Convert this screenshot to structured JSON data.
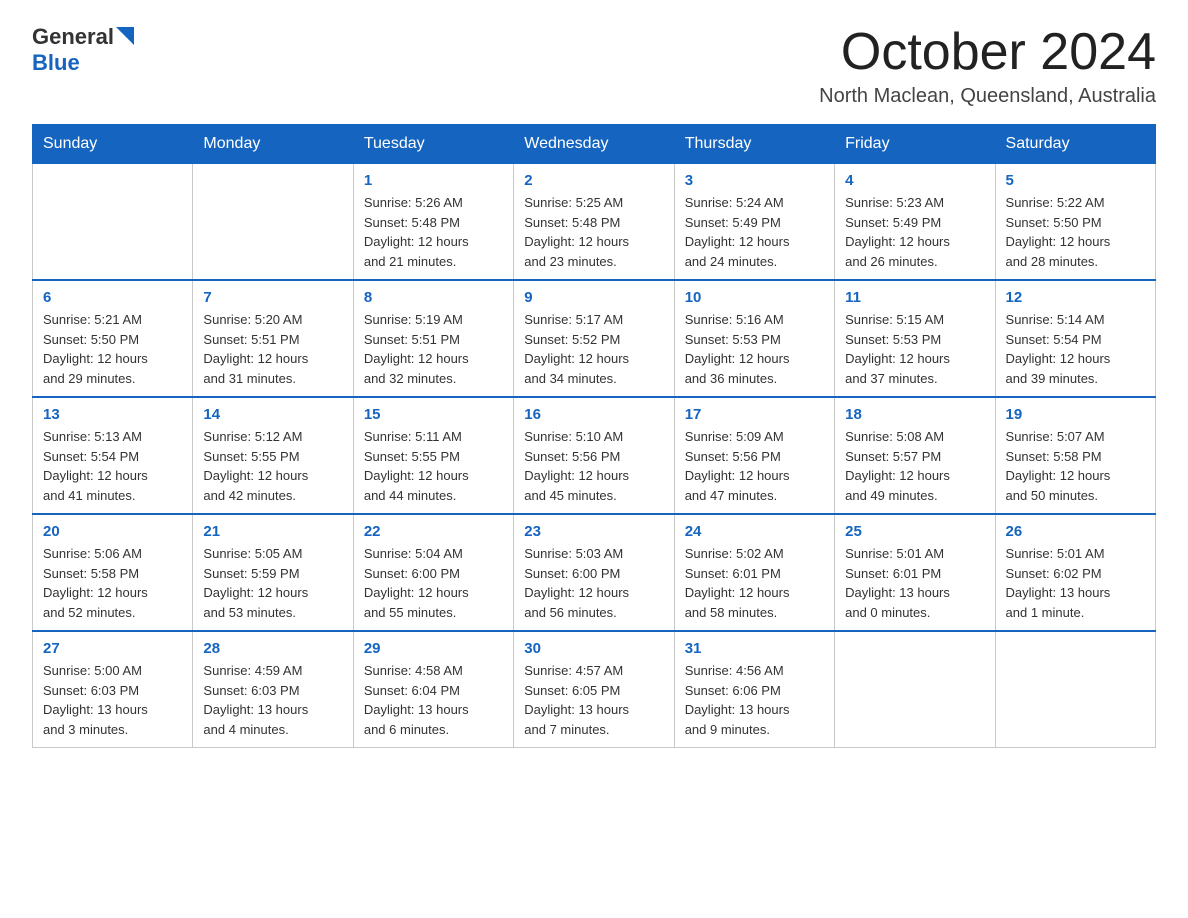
{
  "logo": {
    "general": "General",
    "triangle": "▶",
    "blue": "Blue"
  },
  "title": {
    "month_year": "October 2024",
    "location": "North Maclean, Queensland, Australia"
  },
  "weekdays": [
    "Sunday",
    "Monday",
    "Tuesday",
    "Wednesday",
    "Thursday",
    "Friday",
    "Saturday"
  ],
  "weeks": [
    [
      {
        "day": "",
        "info": ""
      },
      {
        "day": "",
        "info": ""
      },
      {
        "day": "1",
        "info": "Sunrise: 5:26 AM\nSunset: 5:48 PM\nDaylight: 12 hours\nand 21 minutes."
      },
      {
        "day": "2",
        "info": "Sunrise: 5:25 AM\nSunset: 5:48 PM\nDaylight: 12 hours\nand 23 minutes."
      },
      {
        "day": "3",
        "info": "Sunrise: 5:24 AM\nSunset: 5:49 PM\nDaylight: 12 hours\nand 24 minutes."
      },
      {
        "day": "4",
        "info": "Sunrise: 5:23 AM\nSunset: 5:49 PM\nDaylight: 12 hours\nand 26 minutes."
      },
      {
        "day": "5",
        "info": "Sunrise: 5:22 AM\nSunset: 5:50 PM\nDaylight: 12 hours\nand 28 minutes."
      }
    ],
    [
      {
        "day": "6",
        "info": "Sunrise: 5:21 AM\nSunset: 5:50 PM\nDaylight: 12 hours\nand 29 minutes."
      },
      {
        "day": "7",
        "info": "Sunrise: 5:20 AM\nSunset: 5:51 PM\nDaylight: 12 hours\nand 31 minutes."
      },
      {
        "day": "8",
        "info": "Sunrise: 5:19 AM\nSunset: 5:51 PM\nDaylight: 12 hours\nand 32 minutes."
      },
      {
        "day": "9",
        "info": "Sunrise: 5:17 AM\nSunset: 5:52 PM\nDaylight: 12 hours\nand 34 minutes."
      },
      {
        "day": "10",
        "info": "Sunrise: 5:16 AM\nSunset: 5:53 PM\nDaylight: 12 hours\nand 36 minutes."
      },
      {
        "day": "11",
        "info": "Sunrise: 5:15 AM\nSunset: 5:53 PM\nDaylight: 12 hours\nand 37 minutes."
      },
      {
        "day": "12",
        "info": "Sunrise: 5:14 AM\nSunset: 5:54 PM\nDaylight: 12 hours\nand 39 minutes."
      }
    ],
    [
      {
        "day": "13",
        "info": "Sunrise: 5:13 AM\nSunset: 5:54 PM\nDaylight: 12 hours\nand 41 minutes."
      },
      {
        "day": "14",
        "info": "Sunrise: 5:12 AM\nSunset: 5:55 PM\nDaylight: 12 hours\nand 42 minutes."
      },
      {
        "day": "15",
        "info": "Sunrise: 5:11 AM\nSunset: 5:55 PM\nDaylight: 12 hours\nand 44 minutes."
      },
      {
        "day": "16",
        "info": "Sunrise: 5:10 AM\nSunset: 5:56 PM\nDaylight: 12 hours\nand 45 minutes."
      },
      {
        "day": "17",
        "info": "Sunrise: 5:09 AM\nSunset: 5:56 PM\nDaylight: 12 hours\nand 47 minutes."
      },
      {
        "day": "18",
        "info": "Sunrise: 5:08 AM\nSunset: 5:57 PM\nDaylight: 12 hours\nand 49 minutes."
      },
      {
        "day": "19",
        "info": "Sunrise: 5:07 AM\nSunset: 5:58 PM\nDaylight: 12 hours\nand 50 minutes."
      }
    ],
    [
      {
        "day": "20",
        "info": "Sunrise: 5:06 AM\nSunset: 5:58 PM\nDaylight: 12 hours\nand 52 minutes."
      },
      {
        "day": "21",
        "info": "Sunrise: 5:05 AM\nSunset: 5:59 PM\nDaylight: 12 hours\nand 53 minutes."
      },
      {
        "day": "22",
        "info": "Sunrise: 5:04 AM\nSunset: 6:00 PM\nDaylight: 12 hours\nand 55 minutes."
      },
      {
        "day": "23",
        "info": "Sunrise: 5:03 AM\nSunset: 6:00 PM\nDaylight: 12 hours\nand 56 minutes."
      },
      {
        "day": "24",
        "info": "Sunrise: 5:02 AM\nSunset: 6:01 PM\nDaylight: 12 hours\nand 58 minutes."
      },
      {
        "day": "25",
        "info": "Sunrise: 5:01 AM\nSunset: 6:01 PM\nDaylight: 13 hours\nand 0 minutes."
      },
      {
        "day": "26",
        "info": "Sunrise: 5:01 AM\nSunset: 6:02 PM\nDaylight: 13 hours\nand 1 minute."
      }
    ],
    [
      {
        "day": "27",
        "info": "Sunrise: 5:00 AM\nSunset: 6:03 PM\nDaylight: 13 hours\nand 3 minutes."
      },
      {
        "day": "28",
        "info": "Sunrise: 4:59 AM\nSunset: 6:03 PM\nDaylight: 13 hours\nand 4 minutes."
      },
      {
        "day": "29",
        "info": "Sunrise: 4:58 AM\nSunset: 6:04 PM\nDaylight: 13 hours\nand 6 minutes."
      },
      {
        "day": "30",
        "info": "Sunrise: 4:57 AM\nSunset: 6:05 PM\nDaylight: 13 hours\nand 7 minutes."
      },
      {
        "day": "31",
        "info": "Sunrise: 4:56 AM\nSunset: 6:06 PM\nDaylight: 13 hours\nand 9 minutes."
      },
      {
        "day": "",
        "info": ""
      },
      {
        "day": "",
        "info": ""
      }
    ]
  ]
}
